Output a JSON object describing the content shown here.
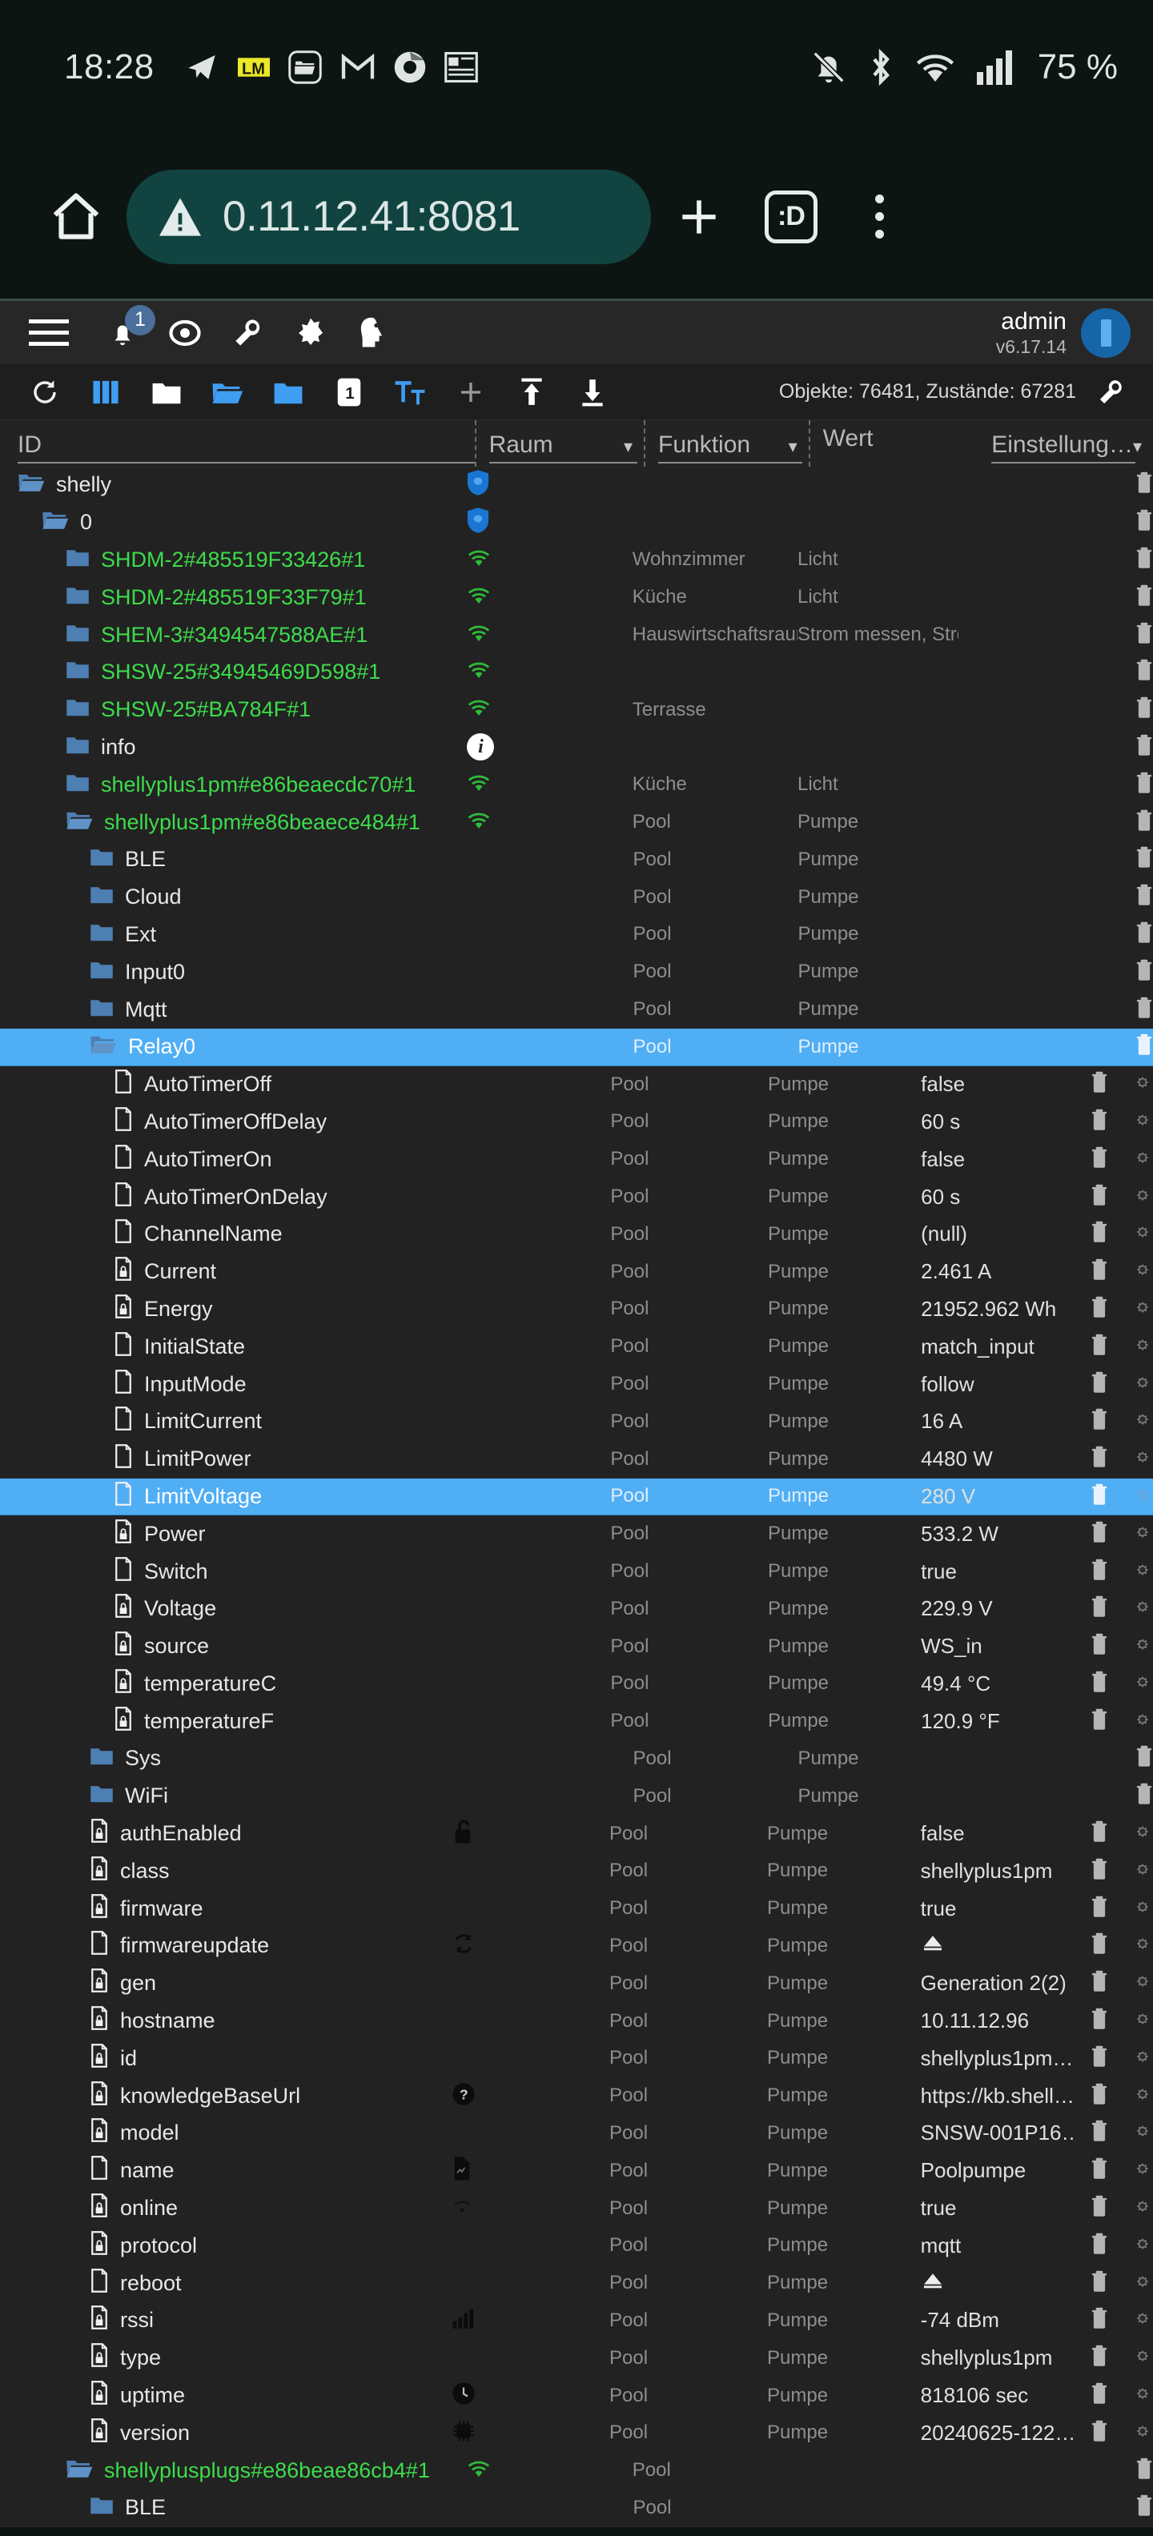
{
  "statusbar": {
    "clock": "18:28",
    "battery": "75 %",
    "left_icons": [
      "telegram-icon",
      "lm-app-icon",
      "file-manager-icon",
      "gmail-icon",
      "chrome-icon",
      "news-icon"
    ],
    "right_icons": [
      "notifications-off-icon",
      "bluetooth-icon",
      "wifi-icon",
      "cellular-signal-icon"
    ]
  },
  "browser": {
    "home_icon": "home-icon",
    "security_icon": "insecure-warning-icon",
    "url": "0.11.12.41:8081",
    "new_tab_icon": "plus-icon",
    "tab_count": ":D",
    "menu_icon": "overflow-menu-icon"
  },
  "appheader": {
    "menu_icon": "hamburger-icon",
    "notification_badge": "1",
    "icons": [
      "bell-icon",
      "eye-icon",
      "wrench-icon",
      "brightness-icon",
      "expert-mode-icon"
    ],
    "username": "admin",
    "version": "v6.17.14"
  },
  "toolbar": {
    "buttons": [
      "refresh-icon",
      "columns-icon",
      "collapse-all-icon",
      "expand-all-icon",
      "folder-icon",
      "page-1-icon",
      "text-size-icon",
      "add-icon",
      "import-icon",
      "export-icon"
    ],
    "stats": "Objekte: 76481, Zustände: 67281",
    "settings_icon": "wrench-icon"
  },
  "columns": {
    "id": "ID",
    "raum": "Raum",
    "funktion": "Funktion",
    "wert": "Wert",
    "einstellung": "Einstellung…"
  },
  "rows": [
    {
      "indent": 0,
      "icon": "folder-open-icon",
      "name": "shelly",
      "name_color": "white",
      "mid": "shield-icon",
      "raum": "",
      "funk": "",
      "wert": "",
      "actions": [
        "delete-icon"
      ],
      "selected": false
    },
    {
      "indent": 1,
      "icon": "folder-open-icon",
      "name": "0",
      "name_color": "white",
      "mid": "shield-icon",
      "raum": "",
      "funk": "",
      "wert": "",
      "actions": [
        "delete-icon"
      ],
      "selected": false
    },
    {
      "indent": 2,
      "icon": "folder-icon",
      "name": "SHDM-2#485519F33426#1",
      "name_color": "green",
      "mid": "wifi-icon",
      "raum": "Wohnzimmer",
      "funk": "Licht",
      "wert": "",
      "actions": [
        "delete-icon"
      ],
      "selected": false
    },
    {
      "indent": 2,
      "icon": "folder-icon",
      "name": "SHDM-2#485519F33F79#1",
      "name_color": "green",
      "mid": "wifi-icon",
      "raum": "Küche",
      "funk": "Licht",
      "wert": "",
      "actions": [
        "delete-icon"
      ],
      "selected": false
    },
    {
      "indent": 2,
      "icon": "folder-icon",
      "name": "SHEM-3#3494547588AE#1",
      "name_color": "green",
      "mid": "wifi-icon",
      "raum": "Hauswirtschaftsraum",
      "funk": "Strom messen, Stromverb…",
      "wert": "",
      "actions": [
        "delete-icon"
      ],
      "selected": false
    },
    {
      "indent": 2,
      "icon": "folder-icon",
      "name": "SHSW-25#34945469D598#1",
      "name_color": "green",
      "mid": "wifi-icon",
      "raum": "",
      "funk": "",
      "wert": "",
      "actions": [
        "delete-icon"
      ],
      "selected": false
    },
    {
      "indent": 2,
      "icon": "folder-icon",
      "name": "SHSW-25#BA784F#1",
      "name_color": "green",
      "mid": "wifi-icon",
      "raum": "Terrasse",
      "funk": "",
      "wert": "",
      "actions": [
        "delete-icon"
      ],
      "selected": false
    },
    {
      "indent": 2,
      "icon": "folder-icon",
      "name": "info",
      "name_color": "white",
      "mid": "info-icon",
      "raum": "",
      "funk": "",
      "wert": "",
      "actions": [
        "delete-icon"
      ],
      "selected": false
    },
    {
      "indent": 2,
      "icon": "folder-icon",
      "name": "shellyplus1pm#e86beaecdc70#1",
      "name_color": "green",
      "mid": "wifi-icon",
      "raum": "Küche",
      "funk": "Licht",
      "wert": "",
      "actions": [
        "delete-icon"
      ],
      "selected": false
    },
    {
      "indent": 2,
      "icon": "folder-open-icon",
      "name": "shellyplus1pm#e86beaece484#1",
      "name_color": "green",
      "mid": "wifi-icon",
      "raum": "Pool",
      "funk": "Pumpe",
      "wert": "",
      "actions": [
        "delete-icon"
      ],
      "selected": false
    },
    {
      "indent": 3,
      "icon": "folder-icon",
      "name": "BLE",
      "name_color": "white",
      "mid": "",
      "raum": "Pool",
      "funk": "Pumpe",
      "wert": "",
      "actions": [
        "delete-icon"
      ],
      "selected": false
    },
    {
      "indent": 3,
      "icon": "folder-icon",
      "name": "Cloud",
      "name_color": "white",
      "mid": "",
      "raum": "Pool",
      "funk": "Pumpe",
      "wert": "",
      "actions": [
        "delete-icon"
      ],
      "selected": false
    },
    {
      "indent": 3,
      "icon": "folder-icon",
      "name": "Ext",
      "name_color": "white",
      "mid": "",
      "raum": "Pool",
      "funk": "Pumpe",
      "wert": "",
      "actions": [
        "delete-icon"
      ],
      "selected": false
    },
    {
      "indent": 3,
      "icon": "folder-icon",
      "name": "Input0",
      "name_color": "white",
      "mid": "",
      "raum": "Pool",
      "funk": "Pumpe",
      "wert": "",
      "actions": [
        "delete-icon"
      ],
      "selected": false
    },
    {
      "indent": 3,
      "icon": "folder-icon",
      "name": "Mqtt",
      "name_color": "white",
      "mid": "",
      "raum": "Pool",
      "funk": "Pumpe",
      "wert": "",
      "actions": [
        "delete-icon"
      ],
      "selected": false
    },
    {
      "indent": 3,
      "icon": "folder-open-icon",
      "name": "Relay0",
      "name_color": "white",
      "mid": "",
      "raum": "Pool",
      "funk": "Pumpe",
      "wert": "",
      "actions": [
        "delete-icon"
      ],
      "selected": true
    },
    {
      "indent": 4,
      "icon": "state-icon",
      "name": "AutoTimerOff",
      "name_color": "white",
      "mid": "",
      "raum": "Pool",
      "funk": "Pumpe",
      "wert": "false",
      "actions": [
        "delete-icon",
        "settings-icon"
      ],
      "selected": false
    },
    {
      "indent": 4,
      "icon": "state-icon",
      "name": "AutoTimerOffDelay",
      "name_color": "white",
      "mid": "",
      "raum": "Pool",
      "funk": "Pumpe",
      "wert": "60 s",
      "actions": [
        "delete-icon",
        "settings-icon"
      ],
      "selected": false
    },
    {
      "indent": 4,
      "icon": "state-icon",
      "name": "AutoTimerOn",
      "name_color": "white",
      "mid": "",
      "raum": "Pool",
      "funk": "Pumpe",
      "wert": "false",
      "actions": [
        "delete-icon",
        "settings-icon"
      ],
      "selected": false
    },
    {
      "indent": 4,
      "icon": "state-icon",
      "name": "AutoTimerOnDelay",
      "name_color": "white",
      "mid": "",
      "raum": "Pool",
      "funk": "Pumpe",
      "wert": "60 s",
      "actions": [
        "delete-icon",
        "settings-icon"
      ],
      "selected": false
    },
    {
      "indent": 4,
      "icon": "state-icon",
      "name": "ChannelName",
      "name_color": "white",
      "mid": "",
      "raum": "Pool",
      "funk": "Pumpe",
      "wert": "(null)",
      "actions": [
        "delete-icon",
        "settings-icon"
      ],
      "selected": false
    },
    {
      "indent": 4,
      "icon": "state-readonly-icon",
      "name": "Current",
      "name_color": "white",
      "mid": "",
      "raum": "Pool",
      "funk": "Pumpe",
      "wert": "2.461 A",
      "actions": [
        "delete-icon",
        "settings-icon"
      ],
      "selected": false
    },
    {
      "indent": 4,
      "icon": "state-readonly-icon",
      "name": "Energy",
      "name_color": "white",
      "mid": "",
      "raum": "Pool",
      "funk": "Pumpe",
      "wert": "21952.962 Wh",
      "actions": [
        "delete-icon",
        "settings-icon"
      ],
      "selected": false
    },
    {
      "indent": 4,
      "icon": "state-icon",
      "name": "InitialState",
      "name_color": "white",
      "mid": "",
      "raum": "Pool",
      "funk": "Pumpe",
      "wert": "match_input",
      "actions": [
        "delete-icon",
        "settings-icon"
      ],
      "selected": false
    },
    {
      "indent": 4,
      "icon": "state-icon",
      "name": "InputMode",
      "name_color": "white",
      "mid": "",
      "raum": "Pool",
      "funk": "Pumpe",
      "wert": "follow",
      "actions": [
        "delete-icon",
        "settings-icon"
      ],
      "selected": false
    },
    {
      "indent": 4,
      "icon": "state-icon",
      "name": "LimitCurrent",
      "name_color": "white",
      "mid": "",
      "raum": "Pool",
      "funk": "Pumpe",
      "wert": "16 A",
      "actions": [
        "delete-icon",
        "settings-icon"
      ],
      "selected": false
    },
    {
      "indent": 4,
      "icon": "state-icon",
      "name": "LimitPower",
      "name_color": "white",
      "mid": "",
      "raum": "Pool",
      "funk": "Pumpe",
      "wert": "4480 W",
      "actions": [
        "delete-icon",
        "settings-icon"
      ],
      "selected": false
    },
    {
      "indent": 4,
      "icon": "state-icon",
      "name": "LimitVoltage",
      "name_color": "white",
      "mid": "",
      "raum": "Pool",
      "funk": "Pumpe",
      "wert": "280 V",
      "actions": [
        "delete-icon",
        "settings-icon"
      ],
      "selected": true
    },
    {
      "indent": 4,
      "icon": "state-readonly-icon",
      "name": "Power",
      "name_color": "white",
      "mid": "",
      "raum": "Pool",
      "funk": "Pumpe",
      "wert": "533.2 W",
      "actions": [
        "delete-icon",
        "settings-icon"
      ],
      "selected": false
    },
    {
      "indent": 4,
      "icon": "state-icon",
      "name": "Switch",
      "name_color": "white",
      "mid": "",
      "raum": "Pool",
      "funk": "Pumpe",
      "wert": "true",
      "actions": [
        "delete-icon",
        "settings-icon"
      ],
      "selected": false
    },
    {
      "indent": 4,
      "icon": "state-readonly-icon",
      "name": "Voltage",
      "name_color": "white",
      "mid": "",
      "raum": "Pool",
      "funk": "Pumpe",
      "wert": "229.9 V",
      "actions": [
        "delete-icon",
        "settings-icon"
      ],
      "selected": false
    },
    {
      "indent": 4,
      "icon": "state-readonly-icon",
      "name": "source",
      "name_color": "white",
      "mid": "",
      "raum": "Pool",
      "funk": "Pumpe",
      "wert": "WS_in",
      "actions": [
        "delete-icon",
        "settings-icon"
      ],
      "selected": false
    },
    {
      "indent": 4,
      "icon": "state-readonly-icon",
      "name": "temperatureC",
      "name_color": "white",
      "mid": "",
      "raum": "Pool",
      "funk": "Pumpe",
      "wert": "49.4 °C",
      "actions": [
        "delete-icon",
        "settings-icon"
      ],
      "selected": false
    },
    {
      "indent": 4,
      "icon": "state-readonly-icon",
      "name": "temperatureF",
      "name_color": "white",
      "mid": "",
      "raum": "Pool",
      "funk": "Pumpe",
      "wert": "120.9 °F",
      "actions": [
        "delete-icon",
        "settings-icon"
      ],
      "selected": false
    },
    {
      "indent": 3,
      "icon": "folder-icon",
      "name": "Sys",
      "name_color": "white",
      "mid": "",
      "raum": "Pool",
      "funk": "Pumpe",
      "wert": "",
      "actions": [
        "delete-icon"
      ],
      "selected": false
    },
    {
      "indent": 3,
      "icon": "folder-icon",
      "name": "WiFi",
      "name_color": "white",
      "mid": "",
      "raum": "Pool",
      "funk": "Pumpe",
      "wert": "",
      "actions": [
        "delete-icon"
      ],
      "selected": false
    },
    {
      "indent": 3,
      "icon": "state-readonly-icon",
      "name": "authEnabled",
      "name_color": "white",
      "mid": "lock-open-icon",
      "raum": "Pool",
      "funk": "Pumpe",
      "wert": "false",
      "actions": [
        "delete-icon",
        "settings-icon"
      ],
      "selected": false
    },
    {
      "indent": 3,
      "icon": "state-readonly-icon",
      "name": "class",
      "name_color": "white",
      "mid": "",
      "raum": "Pool",
      "funk": "Pumpe",
      "wert": "shellyplus1pm",
      "actions": [
        "delete-icon",
        "settings-icon"
      ],
      "selected": false
    },
    {
      "indent": 3,
      "icon": "state-readonly-icon",
      "name": "firmware",
      "name_color": "white",
      "mid": "",
      "raum": "Pool",
      "funk": "Pumpe",
      "wert": "true",
      "actions": [
        "delete-icon",
        "settings-icon"
      ],
      "selected": false
    },
    {
      "indent": 3,
      "icon": "state-icon",
      "name": "firmwareupdate",
      "name_color": "white",
      "mid": "refresh-cycle-icon",
      "raum": "Pool",
      "funk": "Pumpe",
      "wert": "button-icon",
      "wert_is_icon": true,
      "actions": [
        "delete-icon",
        "settings-icon"
      ],
      "selected": false
    },
    {
      "indent": 3,
      "icon": "state-readonly-icon",
      "name": "gen",
      "name_color": "white",
      "mid": "",
      "raum": "Pool",
      "funk": "Pumpe",
      "wert": "Generation 2(2)",
      "actions": [
        "delete-icon",
        "settings-icon"
      ],
      "selected": false
    },
    {
      "indent": 3,
      "icon": "state-readonly-icon",
      "name": "hostname",
      "name_color": "white",
      "mid": "",
      "raum": "Pool",
      "funk": "Pumpe",
      "wert": "10.11.12.96",
      "actions": [
        "delete-icon",
        "settings-icon"
      ],
      "selected": false
    },
    {
      "indent": 3,
      "icon": "state-readonly-icon",
      "name": "id",
      "name_color": "white",
      "mid": "",
      "raum": "Pool",
      "funk": "Pumpe",
      "wert": "shellyplus1pm…",
      "actions": [
        "delete-icon",
        "settings-icon"
      ],
      "selected": false
    },
    {
      "indent": 3,
      "icon": "state-readonly-icon",
      "name": "knowledgeBaseUrl",
      "name_color": "white",
      "mid": "question-mark-icon",
      "raum": "Pool",
      "funk": "Pumpe",
      "wert": "https://kb.shell…",
      "actions": [
        "delete-icon",
        "settings-icon"
      ],
      "selected": false
    },
    {
      "indent": 3,
      "icon": "state-readonly-icon",
      "name": "model",
      "name_color": "white",
      "mid": "",
      "raum": "Pool",
      "funk": "Pumpe",
      "wert": "SNSW-001P16…",
      "actions": [
        "delete-icon",
        "settings-icon"
      ],
      "selected": false
    },
    {
      "indent": 3,
      "icon": "state-icon",
      "name": "name",
      "name_color": "white",
      "mid": "label-icon",
      "raum": "Pool",
      "funk": "Pumpe",
      "wert": "Poolpumpe",
      "actions": [
        "delete-icon",
        "settings-icon"
      ],
      "selected": false
    },
    {
      "indent": 3,
      "icon": "state-readonly-icon",
      "name": "online",
      "name_color": "white",
      "mid": "wifi-small-icon",
      "raum": "Pool",
      "funk": "Pumpe",
      "wert": "true",
      "actions": [
        "delete-icon",
        "settings-icon"
      ],
      "selected": false
    },
    {
      "indent": 3,
      "icon": "state-readonly-icon",
      "name": "protocol",
      "name_color": "white",
      "mid": "",
      "raum": "Pool",
      "funk": "Pumpe",
      "wert": "mqtt",
      "actions": [
        "delete-icon",
        "settings-icon"
      ],
      "selected": false
    },
    {
      "indent": 3,
      "icon": "state-icon",
      "name": "reboot",
      "name_color": "white",
      "mid": "",
      "raum": "Pool",
      "funk": "Pumpe",
      "wert": "button-icon",
      "wert_is_icon": true,
      "actions": [
        "delete-icon",
        "settings-icon"
      ],
      "selected": false
    },
    {
      "indent": 3,
      "icon": "state-readonly-icon",
      "name": "rssi",
      "name_color": "white",
      "mid": "signal-bars-icon",
      "raum": "Pool",
      "funk": "Pumpe",
      "wert": "-74 dBm",
      "actions": [
        "delete-icon",
        "settings-icon"
      ],
      "selected": false
    },
    {
      "indent": 3,
      "icon": "state-readonly-icon",
      "name": "type",
      "name_color": "white",
      "mid": "",
      "raum": "Pool",
      "funk": "Pumpe",
      "wert": "shellyplus1pm",
      "actions": [
        "delete-icon",
        "settings-icon"
      ],
      "selected": false
    },
    {
      "indent": 3,
      "icon": "state-readonly-icon",
      "name": "uptime",
      "name_color": "white",
      "mid": "clock-icon",
      "raum": "Pool",
      "funk": "Pumpe",
      "wert": "818106 sec",
      "actions": [
        "delete-icon",
        "settings-icon"
      ],
      "selected": false
    },
    {
      "indent": 3,
      "icon": "state-readonly-icon",
      "name": "version",
      "name_color": "white",
      "mid": "chip-icon",
      "raum": "Pool",
      "funk": "Pumpe",
      "wert": "20240625-122…",
      "actions": [
        "delete-icon",
        "settings-icon"
      ],
      "selected": false
    },
    {
      "indent": 2,
      "icon": "folder-open-icon",
      "name": "shellyplusplugs#e86beae86cb4#1",
      "name_color": "green",
      "mid": "wifi-icon",
      "raum": "Pool",
      "funk": "",
      "wert": "",
      "actions": [
        "delete-icon"
      ],
      "selected": false
    },
    {
      "indent": 3,
      "icon": "folder-icon",
      "name": "BLE",
      "name_color": "white",
      "mid": "",
      "raum": "Pool",
      "funk": "",
      "wert": "",
      "actions": [
        "delete-icon"
      ],
      "selected": false
    }
  ],
  "colors": {
    "accent_blue": "#50aef5",
    "green_id": "#3ddc4b",
    "bg_row": "#222222",
    "bg_toolbar": "#1e1e1e",
    "bg_header": "#272727",
    "url_pill": "#114440"
  }
}
